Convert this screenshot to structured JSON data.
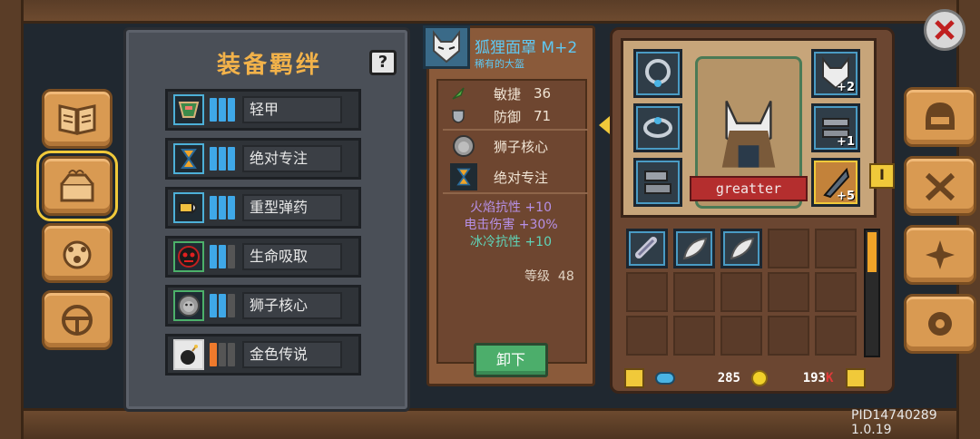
{
  "bonds_panel": {
    "title": "装备羁绊",
    "help_label": "?",
    "bonds": [
      {
        "name": "轻甲",
        "icon": "armor-icon",
        "bars": [
          "on",
          "on",
          "on"
        ]
      },
      {
        "name": "绝对专注",
        "icon": "hourglass-icon",
        "bars": [
          "on",
          "on",
          "on"
        ]
      },
      {
        "name": "重型弹药",
        "icon": "bullet-icon",
        "bars": [
          "on",
          "on",
          "on"
        ]
      },
      {
        "name": "生命吸取",
        "icon": "demon-face-icon",
        "bars": [
          "on",
          "on",
          "off"
        ]
      },
      {
        "name": "狮子核心",
        "icon": "lion-head-icon",
        "bars": [
          "on",
          "on",
          "off"
        ]
      },
      {
        "name": "金色传说",
        "icon": "bomb-icon",
        "bars": [
          "orange",
          "off",
          "off"
        ]
      }
    ]
  },
  "item_detail": {
    "name": "狐狸面罩",
    "grade": "M+2",
    "rarity": "稀有的大盔",
    "stats": [
      {
        "label": "敏捷",
        "value": "36",
        "icon": "feather-icon"
      },
      {
        "label": "防御",
        "value": "71",
        "icon": "shield-icon"
      }
    ],
    "cores": [
      {
        "label": "狮子核心",
        "icon": "lion-head-icon"
      },
      {
        "label": "绝对专注",
        "icon": "hourglass-icon"
      }
    ],
    "bonuses": [
      {
        "text": "火焰抗性 +10",
        "color": "#b690e6"
      },
      {
        "text": "电击伤害 +30%",
        "color": "#b690e6"
      },
      {
        "text": "冰冷抗性 +10",
        "color": "#5fd4b8"
      }
    ],
    "level_label": "等级",
    "level_value": "48",
    "unequip_label": "卸下"
  },
  "equipment": {
    "character_name": "greatter",
    "slot_plus": {
      "mask": "+2",
      "ring": "+1",
      "weapon": "+5"
    },
    "tab_marker": "I"
  },
  "currency": {
    "gems": "285",
    "coins": "193",
    "coins_unit": "K"
  },
  "version": "PID14740289 1.0.19",
  "colors": {
    "accent_gold": "#f2b24a",
    "bar_blue": "#3fa8e8",
    "bar_orange": "#ef7a2c",
    "unequip_green": "#4cae6b",
    "name_plate_red": "#b42e2e"
  }
}
